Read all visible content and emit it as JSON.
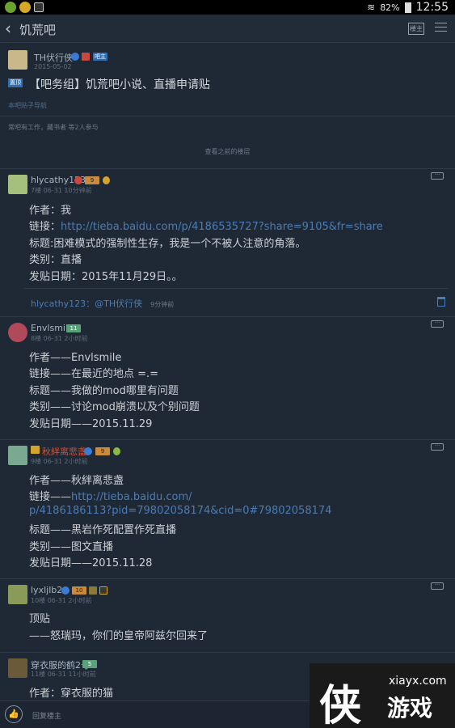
{
  "status_bar": {
    "battery": "82%",
    "time": "12:55"
  },
  "app_bar": {
    "back_label": "饥荒吧",
    "lz_label": "楼主"
  },
  "thread": {
    "author": "TH伏行侠",
    "author_badge": "吧主",
    "date": "2015-05-02",
    "tag": "置顶",
    "title": "【吧务组】饥荒吧小说、直播申请贴",
    "sub_link": "本吧贴子导航",
    "note": "常吧有工作，藏书者 等2人参与",
    "view_previous": "查看之前的楼层"
  },
  "posts": [
    {
      "user": "hlycathy123",
      "level": "9",
      "meta": "7楼 06-31  10分钟前",
      "lines": [
        {
          "text": "作者：我"
        },
        {
          "text": "链接：",
          "link": "http://tieba.baidu.com/p/4186535727?share=9105&fr=share"
        },
        {
          "text": "标题:困难模式的强制性生存，我是一个不被人注意的角落。"
        },
        {
          "text": "类别：直播"
        },
        {
          "text": "发贴日期：2015年11月29日。。"
        }
      ],
      "reply_user": "hlycathy123",
      "reply_text": "：@TH伏行侠",
      "reply_time": "9分钟前"
    },
    {
      "user": "Envlsmile",
      "level": "11",
      "meta": "8楼 06-31  2小时前",
      "lines": [
        {
          "text": "作者——Envlsmile"
        },
        {
          "text": "链接——在最近的地点 =.="
        },
        {
          "text": "标题——我做的mod哪里有问题"
        },
        {
          "text": "类别——讨论mod崩溃以及个别问题"
        },
        {
          "text": "发贴日期——2015.11.29"
        }
      ]
    },
    {
      "user": "秋絆离悲盏",
      "level": "9",
      "meta": "9楼 06-31  2小时前",
      "lines": [
        {
          "text": "作者——秋絆离悲盏"
        },
        {
          "text": "链接——",
          "link": "http://tieba.baidu.com/"
        },
        {
          "text": "",
          "link": "p/4186186113?pid=79802058174&cid=0#79802058174"
        },
        {
          "text": "标题——黑岩作死配置作死直播"
        },
        {
          "text": "类别——图文直播"
        },
        {
          "text": "发贴日期——2015.11.28"
        }
      ]
    },
    {
      "user": "lyxljlb2",
      "level": "10",
      "meta": "10楼 06-31  2小时前",
      "lines": [
        {
          "text": "顶贴"
        },
        {
          "text": "      ——怒瑞玛，你们的皇帝阿兹尔回来了"
        }
      ]
    },
    {
      "user": "穿衣服的鹤2号",
      "level": "5",
      "meta": "11楼 06-31  11小时前",
      "lines": [
        {
          "text": "作者：穿衣服的猫"
        }
      ]
    }
  ],
  "bottom_bar": {
    "reply_hint": "回复楼主"
  },
  "watermark": {
    "cn": "侠",
    "url": "xiayx.com",
    "game": "游戏"
  }
}
